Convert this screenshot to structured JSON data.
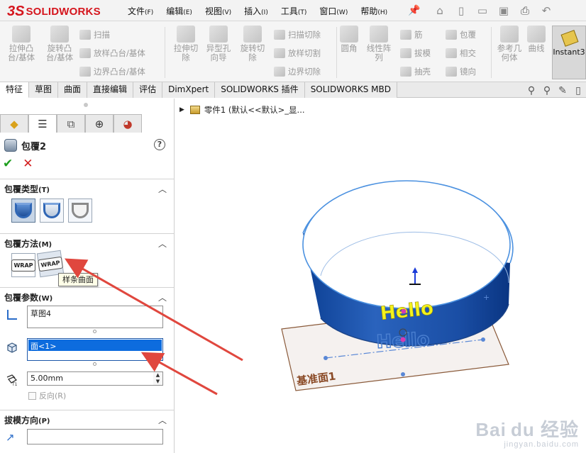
{
  "app": {
    "logo_ds": "3S",
    "logo_name": "SOLIDWORKS"
  },
  "menu": {
    "items": [
      {
        "label": "文件",
        "key": "(F)"
      },
      {
        "label": "编辑",
        "key": "(E)"
      },
      {
        "label": "视图",
        "key": "(V)"
      },
      {
        "label": "插入",
        "key": "(I)"
      },
      {
        "label": "工具",
        "key": "(T)"
      },
      {
        "label": "窗口",
        "key": "(W)"
      },
      {
        "label": "帮助",
        "key": "(H)"
      }
    ]
  },
  "ribbon": {
    "extrude_boss": "拉伸凸\n台/基体",
    "revolve_boss": "旋转凸\n台/基体",
    "sweep": "扫描",
    "loft_boss": "放样凸台/基体",
    "boundary_boss": "边界凸台/基体",
    "extrude_cut": "拉伸切\n除",
    "hole_wizard": "异型孔\n向导",
    "revolve_cut": "旋转切\n除",
    "swept_cut": "扫描切除",
    "lofted_cut": "放样切割",
    "boundary_cut": "边界切除",
    "fillet": "圆角",
    "linear_pattern": "线性阵\n列",
    "rib": "筋",
    "draft": "拔模",
    "shell": "抽壳",
    "wrap": "包覆",
    "intersect": "相交",
    "mirror": "镜向",
    "ref_geometry": "参考几\n何体",
    "curves": "曲线",
    "instant3d": "Instant3"
  },
  "tabs": [
    {
      "label": "特征"
    },
    {
      "label": "草图"
    },
    {
      "label": "曲面"
    },
    {
      "label": "直接编辑"
    },
    {
      "label": "评估"
    },
    {
      "label": "DimXpert"
    },
    {
      "label": "SOLIDWORKS 插件"
    },
    {
      "label": "SOLIDWORKS MBD"
    }
  ],
  "feature": {
    "title": "包覆2",
    "help": "?",
    "ok": "✔",
    "cancel": "✕"
  },
  "groups": {
    "wrap_type": {
      "title": "包覆类型",
      "key": "(T)"
    },
    "wrap_method": {
      "title": "包覆方法",
      "key": "(M)"
    },
    "wrap_params": {
      "title": "包覆参数",
      "key": "(W)"
    },
    "draft_dir": {
      "title": "拔模方向",
      "key": "(P)"
    }
  },
  "wrap_method_labels": {
    "analytic": "WRAP",
    "spline": "WRAP"
  },
  "tooltip": "样条曲面",
  "params": {
    "sketch": "草图4",
    "face": "面<1>",
    "thickness": "5.00mm",
    "reverse": "反向(R)"
  },
  "viewport": {
    "tree_label": "零件1  (默认<<默认>_显...",
    "plane_label": "基准面1",
    "emboss_text": "Hello",
    "ghost_text": "Hello"
  },
  "watermark": {
    "main": "Bai du 经验",
    "sub": "jingyan.baidu.com"
  },
  "colors": {
    "accent_red": "#d5151d",
    "selection_blue": "#0d6cde",
    "body_blue": "#1f56a8",
    "emboss_yellow": "#f3f21c",
    "annotation_arrow": "#e0473e"
  }
}
